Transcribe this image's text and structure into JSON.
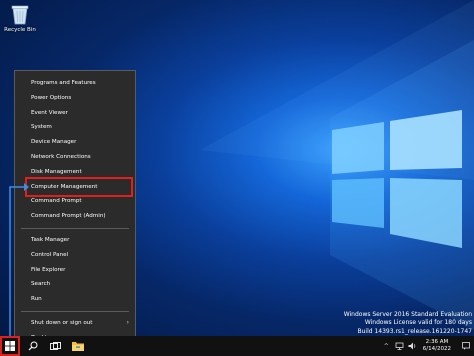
{
  "desktop": {
    "recycle_bin_label": "Recycle Bin"
  },
  "menu": {
    "items": [
      {
        "label": "Programs and Features"
      },
      {
        "label": "Power Options"
      },
      {
        "label": "Event Viewer"
      },
      {
        "label": "System"
      },
      {
        "label": "Device Manager"
      },
      {
        "label": "Network Connections"
      },
      {
        "label": "Disk Management"
      },
      {
        "label": "Computer Management"
      },
      {
        "label": "Command Prompt"
      },
      {
        "label": "Command Prompt (Admin)"
      },
      {
        "label": "Task Manager"
      },
      {
        "label": "Control Panel"
      },
      {
        "label": "File Explorer"
      },
      {
        "label": "Search"
      },
      {
        "label": "Run"
      },
      {
        "label": "Shut down or sign out"
      },
      {
        "label": "Desktop"
      }
    ],
    "highlighted": "Computer Management"
  },
  "watermark": {
    "line1": "Windows Server 2016 Standard Evaluation",
    "line2": "Windows License valid for 180 days",
    "line3": "Build 14393.rs1_release.161220-1747"
  },
  "taskbar": {
    "time": "2:36 AM",
    "date": "6/14/2022",
    "icons": [
      "start-icon",
      "search-icon",
      "task-view-icon",
      "file-explorer-icon"
    ],
    "tray_icons": [
      "chevron-up-icon",
      "network-icon",
      "volume-icon",
      "notifications-icon"
    ]
  },
  "colors": {
    "highlight": "#e0201c",
    "menu_bg": "#2b2b2b",
    "taskbar_bg": "#111111"
  }
}
